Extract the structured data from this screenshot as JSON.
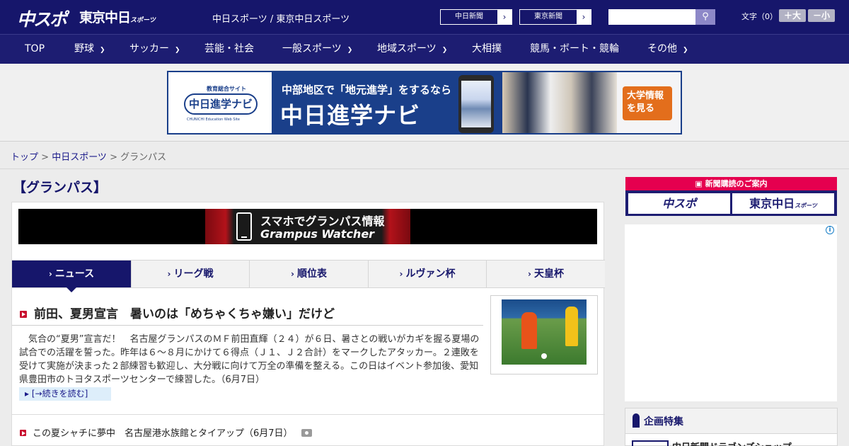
{
  "header": {
    "logo_chusupo": "中スポ",
    "logo_tokyo": "東京中日",
    "logo_tokyo_sub": "スポーツ",
    "site_links": "中日スポーツ / 東京中日スポーツ",
    "ext_links": [
      "中日新聞",
      "東京新聞"
    ],
    "search_placeholder": "",
    "font_size_label": "文字（0）",
    "font_larger": "＋大",
    "font_smaller": "－小",
    "colors": {
      "header_bg": "#16166b",
      "nav_bg": "#1d1d72"
    }
  },
  "nav": {
    "items": [
      {
        "label": "TOP",
        "has_dropdown": false
      },
      {
        "label": "野球",
        "has_dropdown": true
      },
      {
        "label": "サッカー",
        "has_dropdown": true
      },
      {
        "label": "芸能・社会",
        "has_dropdown": false
      },
      {
        "label": "一般スポーツ",
        "has_dropdown": true
      },
      {
        "label": "地域スポーツ",
        "has_dropdown": true
      },
      {
        "label": "大相撲",
        "has_dropdown": false
      },
      {
        "label": "競馬・ボート・競輪",
        "has_dropdown": false
      },
      {
        "label": "その他",
        "has_dropdown": true
      }
    ]
  },
  "banner": {
    "logo_tag": "教育総合サイト",
    "logo_name": "中日進学ナビ",
    "logo_sub": "CHUNICHI Education Web Site",
    "lead": "中部地区で「地元進学」をするなら",
    "title": "中日進学ナビ",
    "cta": "大学情報を見る"
  },
  "breadcrumb": {
    "top": "トップ",
    "sep": " > ",
    "parent": "中日スポーツ",
    "current": "グランパス"
  },
  "main": {
    "section_title": "【グランパス】",
    "gw_banner": {
      "line1": "スマホでグランパス情報",
      "line2": "Grampus Watcher"
    },
    "tabs": [
      {
        "label": "ニュース",
        "active": true
      },
      {
        "label": "リーグ戦",
        "active": false
      },
      {
        "label": "順位表",
        "active": false
      },
      {
        "label": "ルヴァン杯",
        "active": false
      },
      {
        "label": "天皇杯",
        "active": false
      }
    ],
    "lead_article": {
      "headline": "前田、夏男宣言　暑いのは「めちゃくちゃ嫌い」だけど",
      "body": "気合の“夏男”宣言だ！　名古屋グランパスのＭＦ前田直輝（２４）が６日、暑さとの戦いがカギを握る夏場の試合での活躍を誓った。昨年は６～８月にかけて６得点（Ｊ１、Ｊ２合計）をマークしたアタッカー。２連敗を受けて実施が決まった２部練習も歓迎し、大分戦に向けて万全の準備を整える。この日はイベント参加後、愛知県豊田市のトヨタスポーツセンターで練習した。（6月7日）",
      "more": "[→続きを読む]"
    },
    "articles": [
      {
        "title": "この夏シャチに夢中　名古屋港水族館とタイアップ（6月7日）",
        "has_photo": true
      }
    ]
  },
  "sidebar": {
    "subscribe_head": "新聞購読のご案内",
    "subscribe_logos": [
      "中スポ",
      "東京中日"
    ],
    "subscribe_logo_sub": "スポーツ",
    "feature_head": "企画特集",
    "feature_item": "中日新聞ドラゴンズショップ"
  }
}
